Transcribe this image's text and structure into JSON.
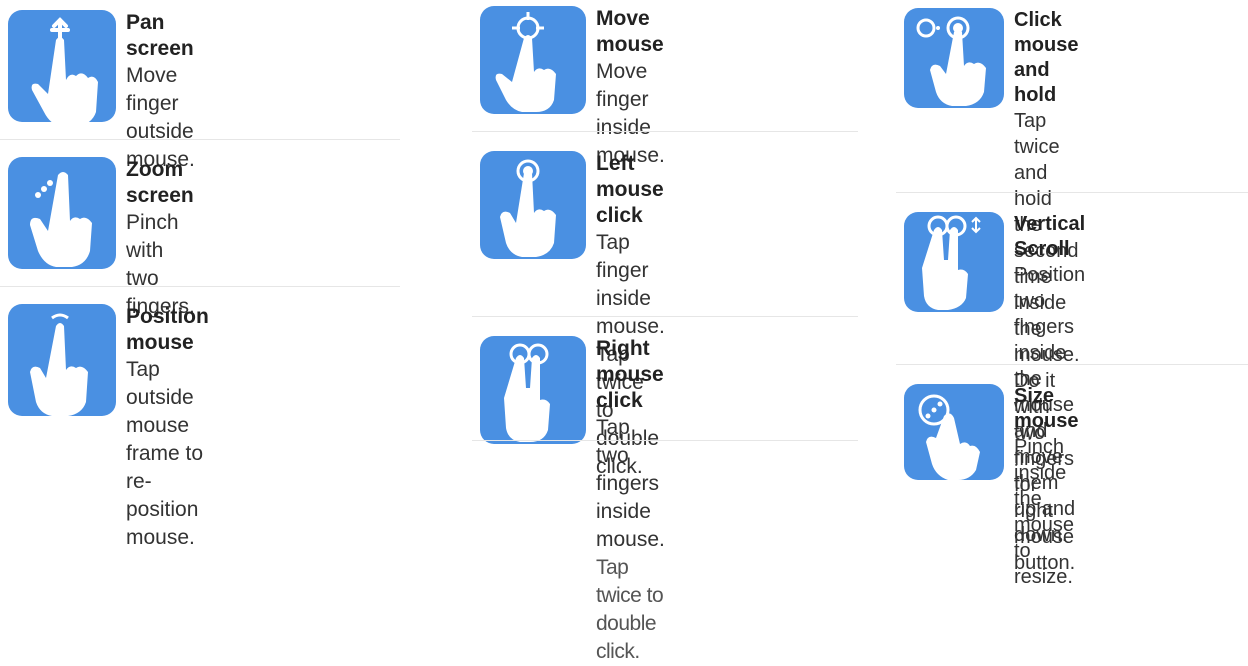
{
  "colors": {
    "tile": "#4a90e2",
    "icon": "#ffffff",
    "separator": "#e6e6e6"
  },
  "columns": [
    {
      "items": [
        {
          "icon": "pan-hand-icon",
          "title": "Pan screen",
          "desc": "Move finger outside\nmouse."
        },
        {
          "icon": "pinch-hand-icon",
          "title": "Zoom screen",
          "desc": "Pinch with two fingers."
        },
        {
          "icon": "point-hand-icon",
          "title": "Position mouse",
          "desc": "Tap outside mouse\nframe to re-position\nmouse."
        }
      ]
    },
    {
      "items": [
        {
          "icon": "move-hand-icon",
          "title": "Move mouse",
          "desc": "Move finger inside\nmouse."
        },
        {
          "icon": "tap-hand-icon",
          "title": "Left mouse click",
          "desc": "Tap finger inside\nmouse.\nTap twice to double\nclick."
        },
        {
          "icon": "two-finger-tap-icon",
          "title": "Right mouse click",
          "desc": "Tap two fingers inside\nmouse.",
          "desc_extra": "Tap twice to double\nclick."
        }
      ]
    },
    {
      "items": [
        {
          "icon": "hold-hand-icon",
          "title": "Click mouse and hold",
          "desc": "Tap twice and hold the\nsecond time inside the\nmouse. Do it with two\nfingers for right mouse\nbutton."
        },
        {
          "icon": "two-finger-scroll-icon",
          "title": "Vertical Scroll",
          "desc": "Position two fingers\ninside the mouse and\nmove them up and\ndown."
        },
        {
          "icon": "resize-hand-icon",
          "title": "Size mouse",
          "desc": "Pinch inside the mouse\nto resize."
        }
      ]
    }
  ]
}
